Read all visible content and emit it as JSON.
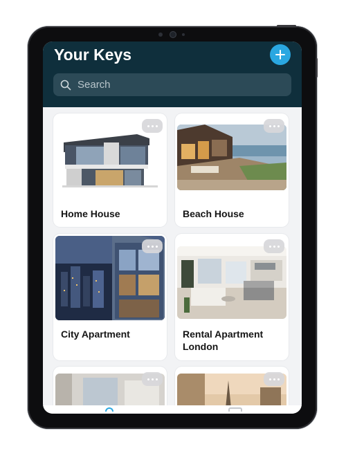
{
  "header": {
    "title": "Your Keys"
  },
  "search": {
    "placeholder": "Search"
  },
  "colors": {
    "header_bg": "#0f2f3c",
    "accent": "#2aa7e1",
    "search_bg": "#2c4a57"
  },
  "icons": {
    "add": "plus-icon",
    "search": "magnifier-icon",
    "card_menu": "more-horizontal-icon"
  },
  "cards": [
    {
      "title": "Home House"
    },
    {
      "title": "Beach House"
    },
    {
      "title": "City Apartment"
    },
    {
      "title": "Rental Apartment London"
    },
    {
      "title": ""
    },
    {
      "title": ""
    }
  ]
}
